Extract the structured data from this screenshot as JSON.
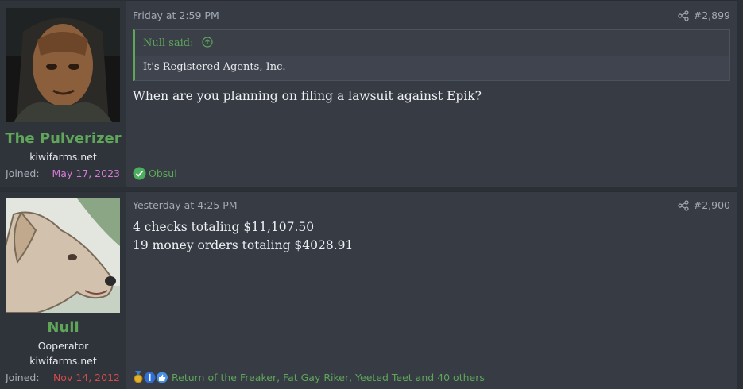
{
  "posts": [
    {
      "username": "The Pulverizer",
      "user_title": "kiwifarms.net",
      "joined_label": "Joined:",
      "joined_date": "May 17, 2023",
      "joined_color": "#d57bd6",
      "date": "Friday at 2:59 PM",
      "post_number": "#2,899",
      "quote": {
        "author": "Null said:",
        "text": "It's Registered Agents, Inc."
      },
      "message": [
        "When are you planning on filing a lawsuit against Epik?"
      ],
      "reactions_text": "Obsul",
      "avatar_icon": "alien-portrait-avatar"
    },
    {
      "username": "Null",
      "user_title": "Ooperator",
      "user_title_2": "kiwifarms.net",
      "joined_label": "Joined:",
      "joined_date": "Nov 14, 2012",
      "joined_color": "#d24b4b",
      "date": "Yesterday at 4:25 PM",
      "post_number": "#2,900",
      "message": [
        "4 checks totaling $11,107.50",
        "19 money orders totaling $4028.91"
      ],
      "reactions_text": "Return of the Freaker, Fat Gay Riker, Yeeted Teet and 40 others",
      "avatar_icon": "dog-drawing-avatar"
    }
  ],
  "colors": {
    "accent": "#5fa65a",
    "background": "#363b44"
  }
}
